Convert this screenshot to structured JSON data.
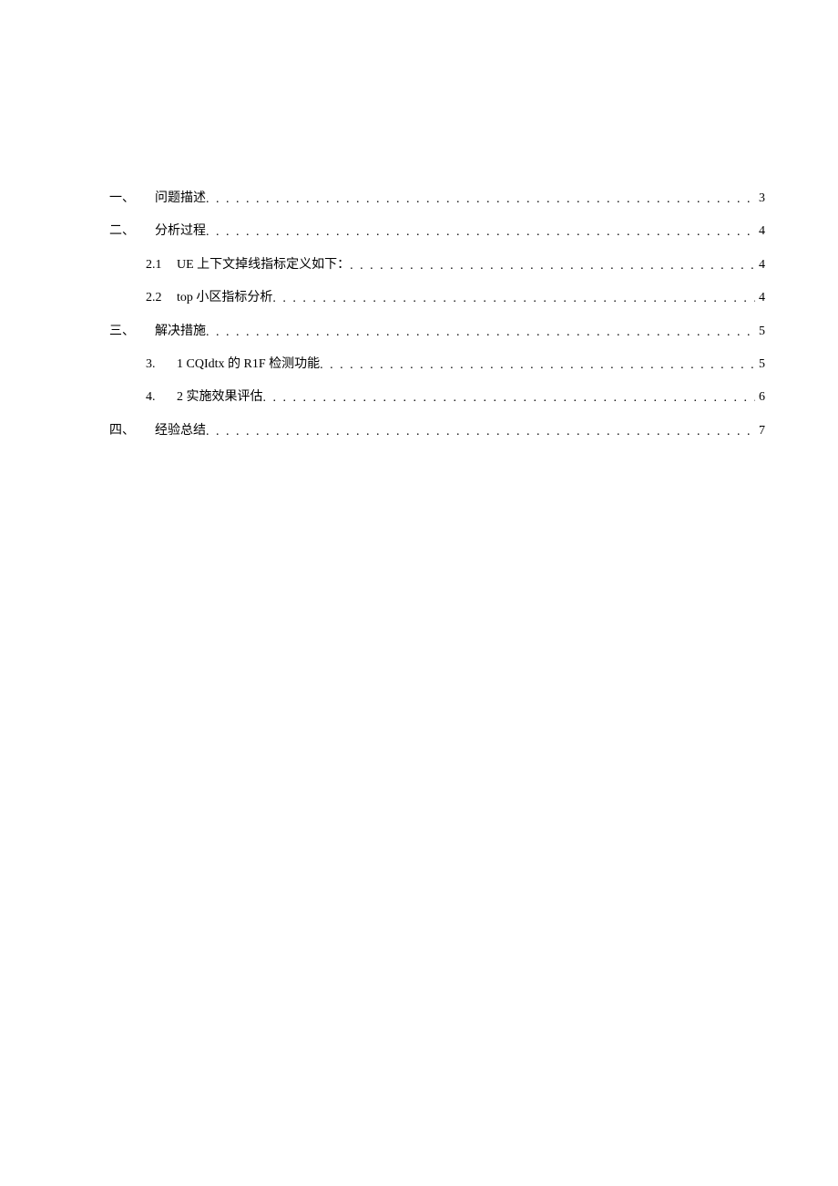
{
  "toc": [
    {
      "level": 1,
      "num": "一、",
      "text": "问题描述",
      "page": "3"
    },
    {
      "level": 1,
      "num": "二、",
      "text": "分析过程",
      "page": "4"
    },
    {
      "level": 2,
      "num": "2.1",
      "text": "UE 上下文掉线指标定义如下：",
      "page": "4"
    },
    {
      "level": 2,
      "num": "2.2",
      "text": "top 小区指标分析",
      "page": "4"
    },
    {
      "level": 1,
      "num": "三、",
      "text": "解决措施",
      "page": "5"
    },
    {
      "level": 2,
      "num": "3.",
      "text": "1 CQIdtx 的 R1F 检测功能",
      "page": "5"
    },
    {
      "level": 2,
      "num": "4.",
      "text": "2 实施效果评估",
      "page": "6"
    },
    {
      "level": 1,
      "num": "四、",
      "text": "经验总结",
      "page": "7"
    }
  ]
}
